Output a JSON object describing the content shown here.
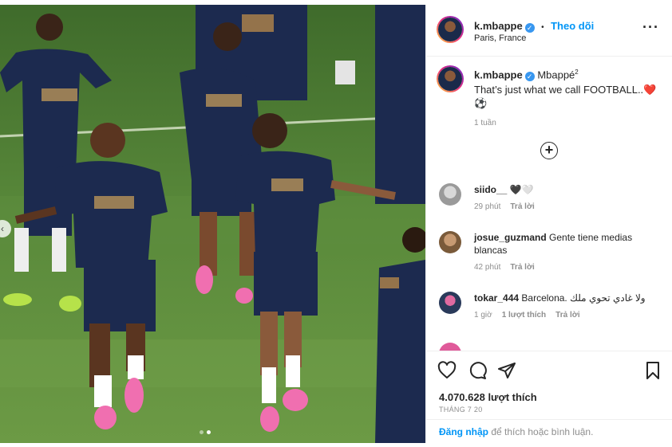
{
  "post": {
    "username": "k.mbappe",
    "follow_label": "Theo dõi",
    "separator": "•",
    "location": "Paris, France",
    "more_label": "···"
  },
  "caption": {
    "username": "k.mbappe",
    "display_name": "Mbappé",
    "superscript": "2",
    "text": "That’s just what we call FOOTBALL..❤️",
    "emoji_line": "⚽",
    "time": "1 tuần"
  },
  "comments": [
    {
      "username": "siido__",
      "text": "🖤🤍",
      "time": "29 phút",
      "reply": "Trả lời",
      "likes": ""
    },
    {
      "username": "josue_guzmand",
      "text": "Gente tiene medias blancas",
      "time": "42 phút",
      "reply": "Trả lời",
      "likes": ""
    },
    {
      "username": "tokar_444",
      "text": "Barcelona. ولا غادي تحوي ملك",
      "time": "1 giờ",
      "likes": "1 lượt thích",
      "reply": "Trả lời"
    }
  ],
  "stats": {
    "likes": "4.070.628 lượt thích",
    "date": "THÁNG 7 20"
  },
  "footer": {
    "login_link": "Đăng nhập",
    "login_rest": " để thích hoặc bình luận."
  },
  "icons": {
    "like": "heart-icon",
    "comment": "comment-icon",
    "share": "paper-plane-icon",
    "save": "bookmark-icon",
    "add": "plus-circle-icon",
    "prev": "chevron-left-icon"
  },
  "colors": {
    "link": "#0095f6",
    "muted": "#8e8e8e",
    "jersey": "#1c2a4f",
    "grass": "#4c7a34"
  },
  "carousel": {
    "count": 2,
    "active": 2
  }
}
